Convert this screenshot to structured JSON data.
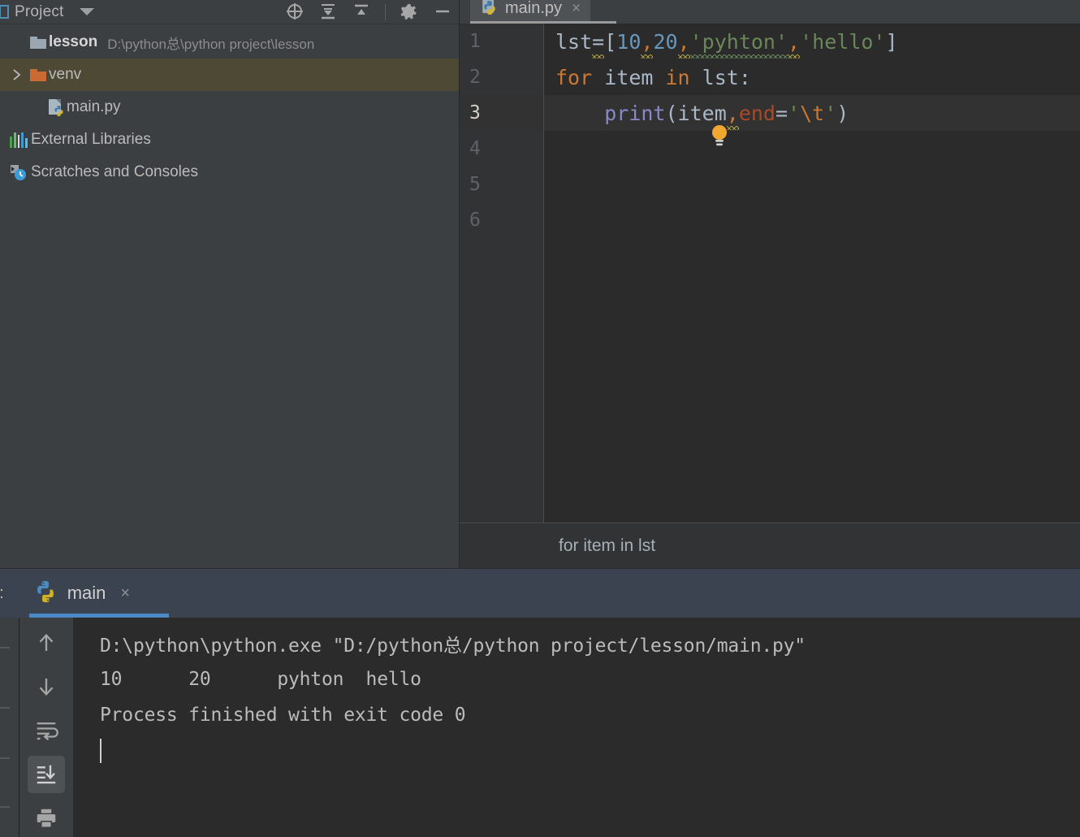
{
  "project_panel": {
    "title": "Project",
    "window_icon": "project-window-icon",
    "dropdown_icon": "chevron-down-icon",
    "toolbar": [
      {
        "name": "locate-target-icon",
        "label": "Select Opened File"
      },
      {
        "name": "expand-all-icon",
        "label": "Expand All"
      },
      {
        "name": "collapse-all-icon",
        "label": "Collapse All"
      },
      {
        "name": "settings-gear-icon",
        "label": "Settings"
      },
      {
        "name": "hide-minimize-icon",
        "label": "Hide"
      }
    ],
    "tree": [
      {
        "label": "lesson",
        "sublabel": "D:\\python总\\python project\\lesson",
        "icon": "folder-gray-icon",
        "arrow": "",
        "selected": false,
        "bold": true
      },
      {
        "label": "venv",
        "sublabel": "",
        "icon": "folder-orange-icon",
        "arrow": "chevron-right-icon",
        "selected": true,
        "bold": false
      },
      {
        "label": "main.py",
        "sublabel": "",
        "icon": "python-file-icon",
        "arrow": "",
        "selected": false,
        "bold": false
      },
      {
        "label": "External Libraries",
        "sublabel": "",
        "icon": "external-libraries-icon",
        "arrow": "",
        "selected": false,
        "bold": false
      },
      {
        "label": "Scratches and Consoles",
        "sublabel": "",
        "icon": "scratches-consoles-icon",
        "arrow": "",
        "selected": false,
        "bold": false
      }
    ]
  },
  "editor": {
    "tab": {
      "label": "main.py",
      "icon": "python-file-icon",
      "close": "×"
    },
    "line_numbers": [
      "1",
      "2",
      "3",
      "4",
      "5",
      "6"
    ],
    "current_line": 3,
    "gutter_bulb_icon": "intention-bulb-icon",
    "lines": [
      {
        "n": 1,
        "text": "lst=[10,20,'pyhton','hello']",
        "tokens": [
          {
            "t": "lst",
            "c": "plain"
          },
          {
            "t": "=",
            "c": "plain",
            "squiggle": "warn"
          },
          {
            "t": "[",
            "c": "punct"
          },
          {
            "t": "10",
            "c": "num"
          },
          {
            "t": ",",
            "c": "comma",
            "squiggle": "warn"
          },
          {
            "t": "20",
            "c": "num"
          },
          {
            "t": ",",
            "c": "comma",
            "squiggle": "warn"
          },
          {
            "t": "'pyhton'",
            "c": "str",
            "squiggle": "spell"
          },
          {
            "t": ",",
            "c": "comma",
            "squiggle": "warn"
          },
          {
            "t": "'hello'",
            "c": "str"
          },
          {
            "t": "]",
            "c": "punct"
          }
        ]
      },
      {
        "n": 2,
        "text": "for item in lst:",
        "tokens": [
          {
            "t": "for",
            "c": "kw"
          },
          {
            "t": " ",
            "c": "plain"
          },
          {
            "t": "item",
            "c": "plain"
          },
          {
            "t": " ",
            "c": "plain"
          },
          {
            "t": "in",
            "c": "kw"
          },
          {
            "t": " ",
            "c": "plain"
          },
          {
            "t": "lst",
            "c": "plain"
          },
          {
            "t": ":",
            "c": "punct"
          }
        ]
      },
      {
        "n": 3,
        "text": "    print(item,end='\\t')",
        "tokens": [
          {
            "t": "    ",
            "c": "plain"
          },
          {
            "t": "print",
            "c": "func"
          },
          {
            "t": "(",
            "c": "punct"
          },
          {
            "t": "item",
            "c": "plain"
          },
          {
            "t": ",",
            "c": "comma",
            "squiggle": "warn"
          },
          {
            "t": "end",
            "c": "param"
          },
          {
            "t": "=",
            "c": "punct"
          },
          {
            "t": "'",
            "c": "str"
          },
          {
            "t": "\\t",
            "c": "esc"
          },
          {
            "t": "'",
            "c": "str"
          },
          {
            "t": ")",
            "c": "punct"
          }
        ]
      },
      {
        "n": 4,
        "text": "",
        "tokens": []
      },
      {
        "n": 5,
        "text": "",
        "tokens": []
      },
      {
        "n": 6,
        "text": "",
        "tokens": []
      }
    ],
    "breadcrumb": "for item in lst"
  },
  "run_panel": {
    "label": "n:",
    "tab": {
      "label": "main",
      "icon": "python-icon",
      "close": "×"
    },
    "toolbar": [
      {
        "name": "scroll-up-icon",
        "label": "Up the stack trace",
        "active": false
      },
      {
        "name": "scroll-down-icon",
        "label": "Down the stack trace",
        "active": false
      },
      {
        "name": "soft-wrap-icon",
        "label": "Soft-Wrap",
        "active": false
      },
      {
        "name": "scroll-to-end-icon",
        "label": "Scroll to the end",
        "active": true
      },
      {
        "name": "print-icon",
        "label": "Print",
        "active": false
      }
    ],
    "console_lines": [
      "D:\\python\\python.exe \"D:/python总/python project/lesson/main.py\"",
      "10\t20\tpyhton\thello",
      "Process finished with exit code 0"
    ],
    "caret_visible": true
  },
  "colors": {
    "panel_bg": "#3c3f41",
    "editor_bg": "#2b2b2b",
    "gutter_bg": "#313335",
    "selection_bg": "#4e4935",
    "run_header_bg": "#3c4350",
    "accent_blue": "#4a88c7",
    "keyword_orange": "#cc7832",
    "number_blue": "#6897bb",
    "string_green": "#6a8759",
    "func_violet": "#8888c6",
    "param_red": "#aa4926",
    "text_gray": "#a9b7c6"
  }
}
